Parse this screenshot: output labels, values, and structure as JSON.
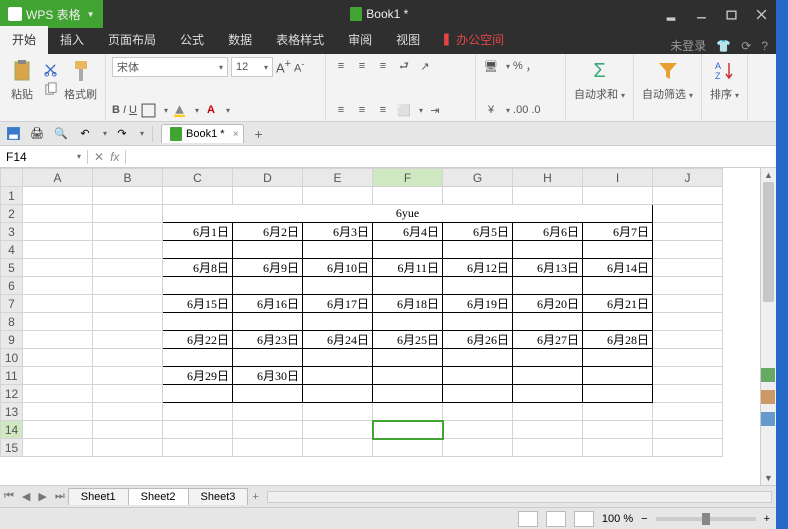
{
  "app": {
    "name": "WPS 表格",
    "doc_title": "Book1 *"
  },
  "winbtns": {
    "min": "－",
    "max": "□",
    "close": "×",
    "down": "▾"
  },
  "menu": {
    "tabs": [
      "开始",
      "插入",
      "页面布局",
      "公式",
      "数据",
      "表格样式",
      "审阅",
      "视图"
    ],
    "office": "办公空间",
    "active": 0,
    "login": "未登录"
  },
  "ribbon": {
    "paste": "粘贴",
    "format_painter": "格式刷",
    "font_name": "宋体",
    "font_size": "12",
    "bold": "B",
    "italic": "I",
    "underline": "U",
    "autosum": "自动求和",
    "autofilter": "自动筛选",
    "sort": "排序"
  },
  "doctab": {
    "name": "Book1 *"
  },
  "fx": {
    "cellref": "F14",
    "fx": "fx"
  },
  "cols": [
    "A",
    "B",
    "C",
    "D",
    "E",
    "F",
    "G",
    "H",
    "I",
    "J"
  ],
  "rows_start": 1,
  "rows_end": 15,
  "sel": {
    "col": "F",
    "row": 14
  },
  "chart_data": {
    "type": "table",
    "title": "6yue",
    "title_range": "C2:I2",
    "data_rows": [
      {
        "row": 3,
        "cells": [
          "6月1日",
          "6月2日",
          "6月3日",
          "6月4日",
          "6月5日",
          "6月6日",
          "6月7日"
        ]
      },
      {
        "row": 5,
        "cells": [
          "6月8日",
          "6月9日",
          "6月10日",
          "6月11日",
          "6月12日",
          "6月13日",
          "6月14日"
        ]
      },
      {
        "row": 7,
        "cells": [
          "6月15日",
          "6月16日",
          "6月17日",
          "6月18日",
          "6月19日",
          "6月20日",
          "6月21日"
        ]
      },
      {
        "row": 9,
        "cells": [
          "6月22日",
          "6月23日",
          "6月24日",
          "6月25日",
          "6月26日",
          "6月27日",
          "6月28日"
        ]
      },
      {
        "row": 11,
        "cells": [
          "6月29日",
          "6月30日",
          "",
          "",
          "",
          "",
          ""
        ]
      }
    ],
    "bordered_range": "C2:I12"
  },
  "sheets": {
    "tabs": [
      "Sheet1",
      "Sheet2",
      "Sheet3"
    ],
    "active": 1
  },
  "status": {
    "zoom": "100 %"
  }
}
